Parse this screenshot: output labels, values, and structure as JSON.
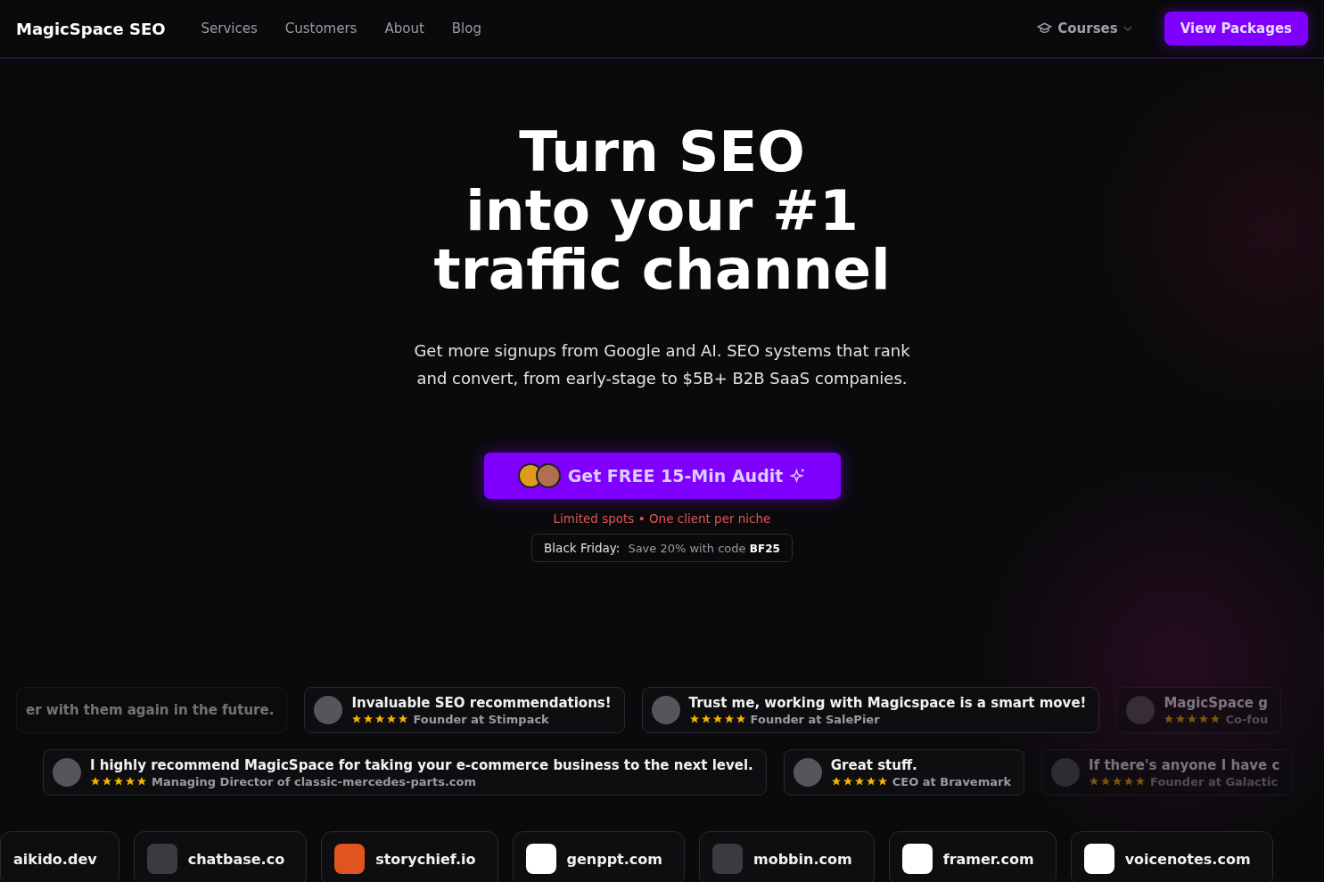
{
  "nav": {
    "brand": "MagicSpace SEO",
    "links": [
      "Services",
      "Customers",
      "About",
      "Blog"
    ],
    "courses": "Courses",
    "cta": "View Packages"
  },
  "hero": {
    "title_lines": [
      "Turn SEO",
      "into your #1",
      "traffic channel"
    ],
    "subtitle_lines": [
      "Get more signups from Google and AI. SEO systems that rank",
      "and convert, from early-stage to $5B+ B2B SaaS companies."
    ],
    "button": "Get FREE 15-Min Audit",
    "note": "Limited spots • One client per niche",
    "promo": {
      "label": "Black Friday:",
      "text": "Save 20% with code",
      "code": "BF25"
    }
  },
  "testimonial_rows": [
    [
      {
        "quote": "er with them again in the future.",
        "faded": true
      },
      {
        "quote": "Invaluable SEO recommendations!",
        "stars": 5,
        "role": "Founder at Stimpack",
        "faded": false
      },
      {
        "quote": "Trust me, working with Magicspace is a smart move!",
        "stars": 5,
        "role": "Founder at SalePier",
        "faded": false
      },
      {
        "quote": "MagicSpace g",
        "stars": 5,
        "role": "Co-fou",
        "faded": true
      }
    ],
    [
      {
        "quote": "I highly recommend MagicSpace for taking your e-commerce business to the next level.",
        "stars": 5,
        "role": "Managing Director of classic-mercedes-parts.com",
        "faded": false
      },
      {
        "quote": "Great stuff.",
        "stars": 5,
        "role": "CEO at Bravemark",
        "faded": false
      },
      {
        "quote": "If there's anyone I have c",
        "stars": 5,
        "role": "Founder at Galactic",
        "faded": true
      }
    ]
  ],
  "clients": [
    {
      "name": "aikido.dev",
      "kind": "text"
    },
    {
      "name": "chatbase.co",
      "kind": "logo"
    },
    {
      "name": "storychief.io",
      "kind": "logo"
    },
    {
      "name": "genppt.com",
      "kind": "logo"
    },
    {
      "name": "mobbin.com",
      "kind": "logo"
    },
    {
      "name": "framer.com",
      "kind": "logo"
    },
    {
      "name": "voicenotes.com",
      "kind": "logo"
    }
  ]
}
